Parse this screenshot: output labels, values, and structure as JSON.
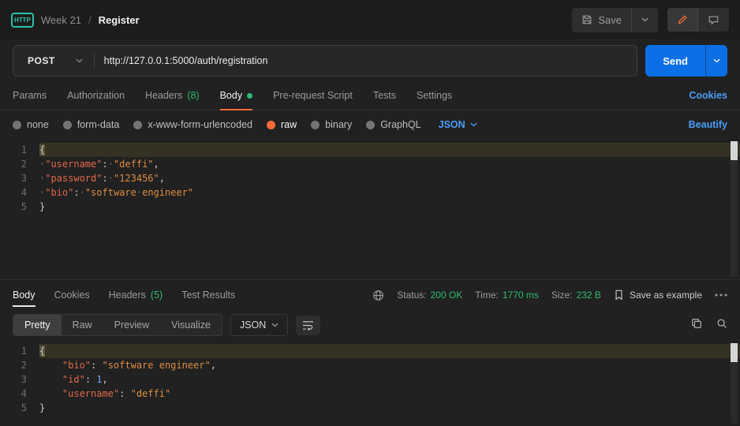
{
  "colors": {
    "accent-orange": "#ff6c37",
    "send-blue": "#0b6fe5",
    "link-blue": "#4a9df8",
    "success-green": "#2ebd6f",
    "badge-teal": "#2cc0a8",
    "code-key": "#e2674d",
    "code-string": "#de8d44",
    "code-number": "#79abe8"
  },
  "header": {
    "protocol_badge": "HTTP",
    "workspace": "Week 21",
    "separator": "/",
    "request_name": "Register",
    "save_label": "Save"
  },
  "request_bar": {
    "method": "POST",
    "url": "http://127.0.0.1:5000/auth/registration",
    "send_label": "Send"
  },
  "request_tabs": {
    "params": "Params",
    "authorization": "Authorization",
    "headers": "Headers",
    "headers_count": "(8)",
    "body": "Body",
    "pre_request": "Pre-request Script",
    "tests": "Tests",
    "settings": "Settings",
    "cookies": "Cookies"
  },
  "body_options": {
    "none": "none",
    "form_data": "form-data",
    "urlencoded": "x-www-form-urlencoded",
    "raw": "raw",
    "binary": "binary",
    "graphql": "GraphQL",
    "format": "JSON",
    "beautify": "Beautify"
  },
  "request_body": {
    "lines": [
      {
        "no": 1,
        "active": true,
        "tokens": [
          {
            "t": "brace",
            "v": "{"
          }
        ]
      },
      {
        "no": 2,
        "tokens": [
          {
            "t": "ws",
            "v": "·"
          },
          {
            "t": "key",
            "v": "\"username\""
          },
          {
            "t": "punct",
            "v": ":"
          },
          {
            "t": "ws",
            "v": "·"
          },
          {
            "t": "str",
            "v": "\"deffi\""
          },
          {
            "t": "punct",
            "v": ","
          }
        ]
      },
      {
        "no": 3,
        "tokens": [
          {
            "t": "ws",
            "v": "·"
          },
          {
            "t": "key",
            "v": "\"password\""
          },
          {
            "t": "punct",
            "v": ":"
          },
          {
            "t": "ws",
            "v": "·"
          },
          {
            "t": "str",
            "v": "\"123456\""
          },
          {
            "t": "punct",
            "v": ","
          }
        ]
      },
      {
        "no": 4,
        "tokens": [
          {
            "t": "ws",
            "v": "·"
          },
          {
            "t": "key",
            "v": "\"bio\""
          },
          {
            "t": "punct",
            "v": ":"
          },
          {
            "t": "ws",
            "v": "·"
          },
          {
            "t": "str",
            "v": "\"software"
          },
          {
            "t": "ws",
            "v": "·"
          },
          {
            "t": "str",
            "v": "engineer\""
          }
        ]
      },
      {
        "no": 5,
        "tokens": [
          {
            "t": "brace",
            "v": "}"
          }
        ]
      }
    ]
  },
  "response": {
    "tabs": {
      "body": "Body",
      "cookies": "Cookies",
      "headers": "Headers",
      "headers_count": "(5)",
      "test_results": "Test Results"
    },
    "meta": {
      "status_label": "Status:",
      "status_value": "200 OK",
      "time_label": "Time:",
      "time_value": "1770 ms",
      "size_label": "Size:",
      "size_value": "232 B",
      "save_as_example": "Save as example"
    },
    "views": {
      "pretty": "Pretty",
      "raw": "Raw",
      "preview": "Preview",
      "visualize": "Visualize",
      "format": "JSON"
    },
    "body_lines": [
      {
        "no": 1,
        "active": true,
        "tokens": [
          {
            "t": "brace",
            "v": "{"
          }
        ]
      },
      {
        "no": 2,
        "tokens": [
          {
            "t": "sp",
            "v": "    "
          },
          {
            "t": "key",
            "v": "\"bio\""
          },
          {
            "t": "punct",
            "v": ": "
          },
          {
            "t": "str",
            "v": "\"software engineer\""
          },
          {
            "t": "punct",
            "v": ","
          }
        ]
      },
      {
        "no": 3,
        "tokens": [
          {
            "t": "sp",
            "v": "    "
          },
          {
            "t": "key",
            "v": "\"id\""
          },
          {
            "t": "punct",
            "v": ": "
          },
          {
            "t": "num",
            "v": "1"
          },
          {
            "t": "punct",
            "v": ","
          }
        ]
      },
      {
        "no": 4,
        "tokens": [
          {
            "t": "sp",
            "v": "    "
          },
          {
            "t": "key",
            "v": "\"username\""
          },
          {
            "t": "punct",
            "v": ": "
          },
          {
            "t": "str",
            "v": "\"deffi\""
          }
        ]
      },
      {
        "no": 5,
        "tokens": [
          {
            "t": "brace",
            "v": "}"
          }
        ]
      }
    ]
  }
}
